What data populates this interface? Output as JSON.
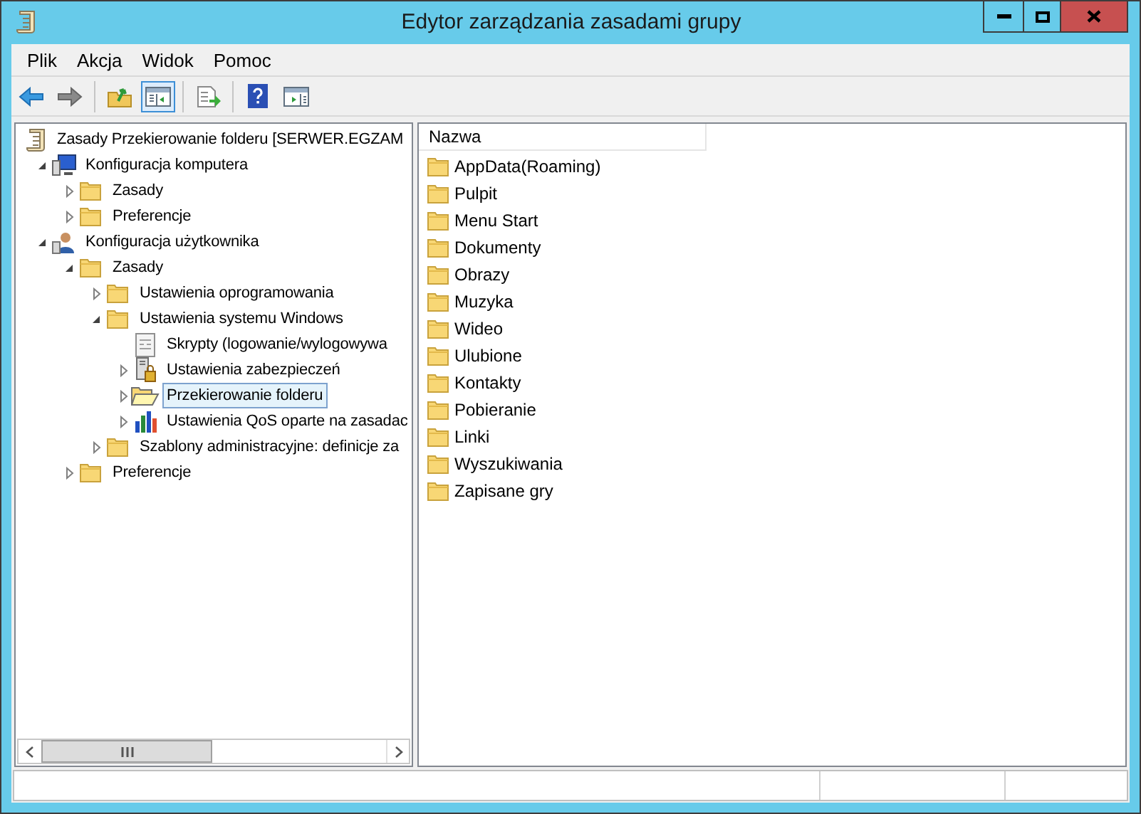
{
  "window": {
    "title": "Edytor zarządzania zasadami grupy"
  },
  "menu": [
    "Plik",
    "Akcja",
    "Widok",
    "Pomoc"
  ],
  "toolbar": [
    {
      "kind": "back",
      "pressed": false
    },
    {
      "kind": "forward",
      "pressed": false
    },
    {
      "kind": "sep"
    },
    {
      "kind": "up",
      "pressed": false
    },
    {
      "kind": "tree",
      "pressed": true
    },
    {
      "kind": "sep"
    },
    {
      "kind": "export",
      "pressed": false
    },
    {
      "kind": "sep"
    },
    {
      "kind": "help",
      "pressed": false
    },
    {
      "kind": "pane",
      "pressed": false
    }
  ],
  "tree": [
    {
      "label": "Zasady Przekierowanie folderu [SERWER.EGZAM",
      "kind": "policy",
      "selected": false,
      "children": [
        {
          "label": "Konfiguracja komputera",
          "kind": "computer",
          "expanded": true,
          "selected": false,
          "children": [
            {
              "label": "Zasady",
              "kind": "folder",
              "expanded": false,
              "selected": false
            },
            {
              "label": "Preferencje",
              "kind": "folder",
              "expanded": false,
              "selected": false
            }
          ]
        },
        {
          "label": "Konfiguracja użytkownika",
          "kind": "user",
          "expanded": true,
          "selected": false,
          "children": [
            {
              "label": "Zasady",
              "kind": "folder",
              "expanded": true,
              "selected": false,
              "children": [
                {
                  "label": "Ustawienia oprogramowania",
                  "kind": "folder",
                  "expanded": false,
                  "selected": false
                },
                {
                  "label": "Ustawienia systemu Windows",
                  "kind": "folder",
                  "expanded": true,
                  "selected": false,
                  "children": [
                    {
                      "label": "Skrypty (logowanie/wylogowywa",
                      "kind": "script",
                      "selected": false
                    },
                    {
                      "label": "Ustawienia zabezpieczeń",
                      "kind": "security",
                      "expanded": false,
                      "selected": false
                    },
                    {
                      "label": "Przekierowanie folderu",
                      "kind": "redirect",
                      "expanded": false,
                      "selected": true
                    },
                    {
                      "label": "Ustawienia QoS oparte na zasadac",
                      "kind": "chart",
                      "expanded": false,
                      "selected": false
                    }
                  ]
                },
                {
                  "label": "Szablony administracyjne: definicje za",
                  "kind": "folder",
                  "expanded": false,
                  "selected": false
                }
              ]
            },
            {
              "label": "Preferencje",
              "kind": "folder",
              "expanded": false,
              "selected": false
            }
          ]
        }
      ]
    }
  ],
  "list": {
    "columns": [
      "Nazwa"
    ],
    "items": [
      "AppData(Roaming)",
      "Pulpit",
      "Menu Start",
      "Dokumenty",
      "Obrazy",
      "Muzyka",
      "Wideo",
      "Ulubione",
      "Kontakty",
      "Pobieranie",
      "Linki",
      "Wyszukiwania",
      "Zapisane gry"
    ]
  }
}
